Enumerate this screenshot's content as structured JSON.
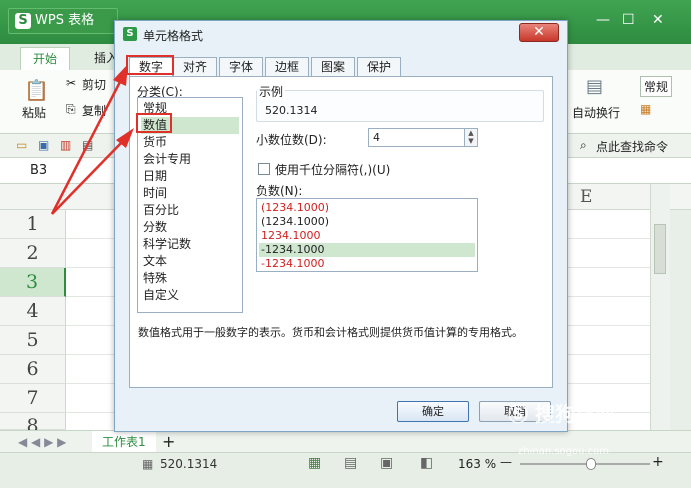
{
  "app": {
    "title": "WPS 表格",
    "logo_letter": "S",
    "ribbon_tabs": [
      "开始",
      "插入"
    ],
    "ribbon": {
      "paste": "粘贴",
      "cut": "剪切",
      "copy": "复制",
      "wrap": "自动换行",
      "normal": "常规",
      "find": "点此查找命令"
    },
    "name_box": "B3",
    "column_label": "E",
    "row_numbers": [
      "1",
      "2",
      "3",
      "4",
      "5",
      "6",
      "7",
      "8"
    ],
    "active_row": "3",
    "sheet_tab": "工作表1",
    "add_sheet": "+",
    "status_value": "520.1314",
    "zoom": "163 %",
    "zoom_minus": "—",
    "zoom_plus": "+"
  },
  "dialog": {
    "title": "单元格格式",
    "close": "✕",
    "tabs": [
      "数字",
      "对齐",
      "字体",
      "边框",
      "图案",
      "保护"
    ],
    "active_tab": "数字",
    "category_label": "分类(C):",
    "categories": [
      "常规",
      "数值",
      "货币",
      "会计专用",
      "日期",
      "时间",
      "百分比",
      "分数",
      "科学记数",
      "文本",
      "特殊",
      "自定义"
    ],
    "selected_category": "数值",
    "sample_label": "示例",
    "sample_value": "520.1314",
    "decimal_label": "小数位数(D):",
    "decimal_value": "4",
    "separator_label": "使用千位分隔符(,)(U)",
    "separator_checked": false,
    "negative_label": "负数(N):",
    "negative_formats": [
      {
        "text": "(1234.1000)",
        "red": true
      },
      {
        "text": "(1234.1000)",
        "red": false
      },
      {
        "text": "1234.1000",
        "red": true
      },
      {
        "text": "-1234.1000",
        "red": false,
        "selected": true
      },
      {
        "text": "-1234.1000",
        "red": true
      }
    ],
    "description": "数值格式用于一般数字的表示。货币和会计格式则提供货币值计算的专用格式。",
    "ok": "确定",
    "cancel": "取消"
  },
  "watermark": {
    "main": "搜狗指南",
    "sub": "zhinan.sogou.com"
  },
  "colors": {
    "wps_green": "#2e8c40",
    "annotation_red": "#e0302a",
    "negative_red": "#d32020",
    "selection_green": "#cfe6cf"
  }
}
